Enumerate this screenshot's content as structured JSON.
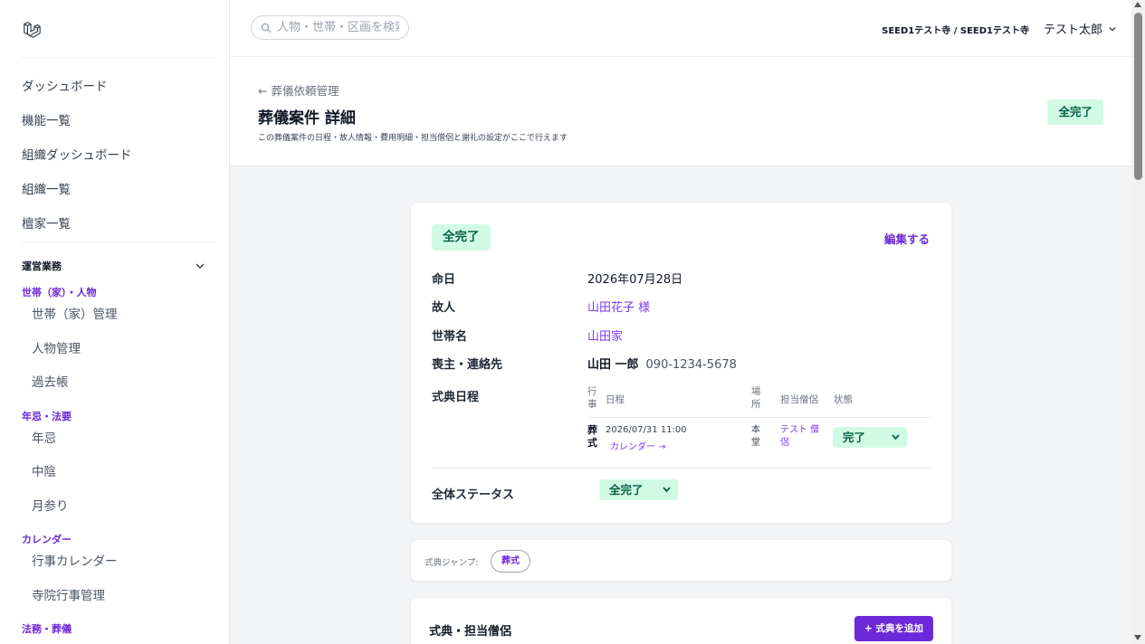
{
  "sidebar": {
    "top_items": [
      "ダッシュボード",
      "機能一覧",
      "組織ダッシュボード",
      "組織一覧",
      "檀家一覧"
    ],
    "section": "運営業務",
    "groups": [
      {
        "title": "世帯（家）・人物",
        "items": [
          "世帯（家）管理",
          "人物管理",
          "過去帳"
        ]
      },
      {
        "title": "年忌・法要",
        "items": [
          "年忌",
          "中陰",
          "月参り"
        ]
      },
      {
        "title": "カレンダー",
        "items": [
          "行事カレンダー",
          "寺院行事管理"
        ]
      },
      {
        "title": "法務・葬儀",
        "items": []
      }
    ]
  },
  "topbar": {
    "search_placeholder": "人物・世帯・区画を検索",
    "tenant": "SEED1テスト寺 / SEED1テスト寺",
    "user": "テスト太郎"
  },
  "header": {
    "back": "← 葬儀依頼管理",
    "title": "葬儀案件 詳細",
    "subtitle": "この葬儀案件の日程・故人情報・費用明細・担当僧侶と謝礼の設定がここで行えます",
    "badge": "全完了"
  },
  "detail": {
    "status_badge": "全完了",
    "edit": "編集する",
    "rows": {
      "death_date": {
        "label": "命日",
        "value": "2026年07月28日"
      },
      "deceased": {
        "label": "故人",
        "value": "山田花子 様"
      },
      "household": {
        "label": "世帯名",
        "value": "山田家"
      },
      "mourner": {
        "label": "喪主・連絡先",
        "name": "山田 一郎",
        "phone": "090-1234-5678"
      },
      "schedule": {
        "label": "式典日程"
      }
    },
    "schedule_table": {
      "headers": {
        "event": "行事",
        "date": "日程",
        "place": "場所",
        "priest": "担当僧侶",
        "status": "状態"
      },
      "rows": [
        {
          "event": "葬式",
          "datetime": "2026/07/31 11:00",
          "calendar_link": "カレンダー →",
          "place": "本堂",
          "priest": "テスト 僧侶",
          "status": "完了"
        }
      ]
    },
    "overall": {
      "label": "全体ステータス",
      "value": "全完了"
    }
  },
  "jump": {
    "label": "式典ジャンプ:",
    "chip": "葬式"
  },
  "ceremony": {
    "title": "式典・担当僧侶",
    "add": "+ 式典を追加"
  }
}
